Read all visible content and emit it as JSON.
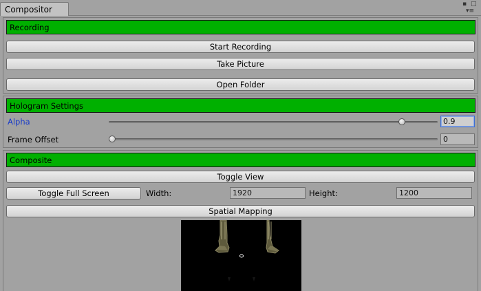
{
  "window": {
    "tab_title": "Compositor",
    "controls": [
      {
        "icon": "lock-icon",
        "glyph": "▪"
      },
      {
        "icon": "maximize-icon",
        "glyph": "□"
      },
      {
        "icon": "menu-icon",
        "glyph": "▾≡"
      }
    ]
  },
  "recording": {
    "header": "Recording",
    "start_recording": "Start Recording",
    "take_picture": "Take Picture",
    "open_folder": "Open Folder"
  },
  "hologram": {
    "header": "Hologram Settings",
    "alpha_label": "Alpha",
    "alpha_value": "0.9",
    "alpha_fraction": 0.9,
    "frame_offset_label": "Frame Offset",
    "frame_offset_value": "0",
    "frame_offset_fraction": 0
  },
  "composite": {
    "header": "Composite",
    "toggle_view": "Toggle View",
    "toggle_full_screen": "Toggle Full Screen",
    "width_label": "Width:",
    "width_value": "1920",
    "height_label": "Height:",
    "height_value": "1200",
    "spatial_mapping": "Spatial Mapping"
  },
  "colors": {
    "header_green": "#00b000",
    "panel_bg": "#a2a2a2",
    "focus_blue": "#3e6fd3",
    "alpha_label_blue": "#1a3cc8"
  }
}
